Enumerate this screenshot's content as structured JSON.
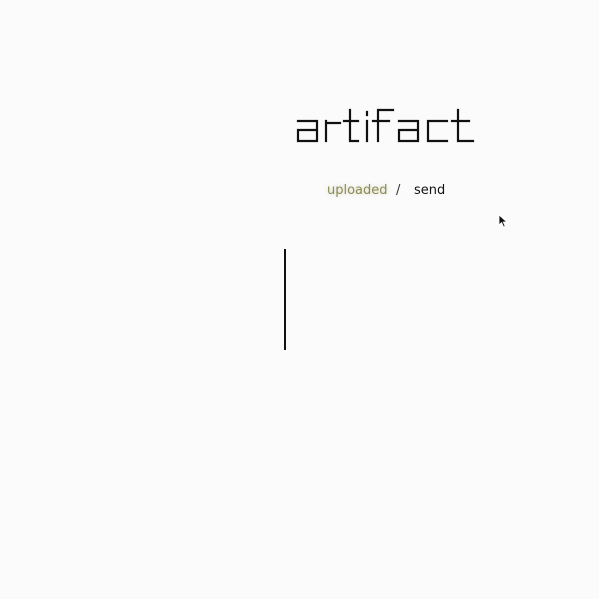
{
  "brand": {
    "title": "artifact"
  },
  "nav": {
    "tabs": [
      {
        "label": "uploaded",
        "active": true
      },
      {
        "label": "send",
        "active": false
      }
    ],
    "separator": "/"
  },
  "colors": {
    "background": "#fbfbfb",
    "text": "#111111",
    "active_tab": "#8a8b54"
  },
  "icons": {
    "pointer": "mouse-pointer-icon"
  }
}
